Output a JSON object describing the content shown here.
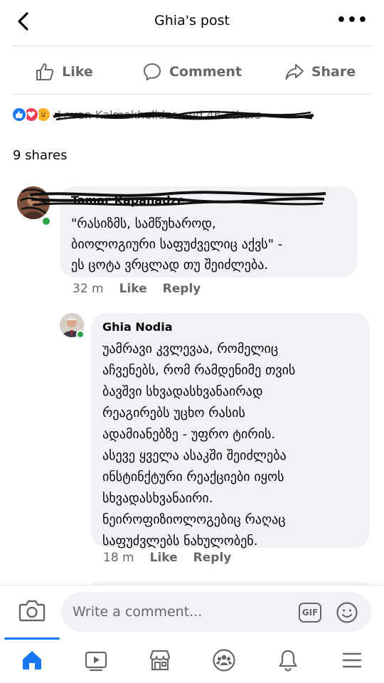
{
  "header": {
    "title": "Ghia's post",
    "more_label": "•••"
  },
  "actions": [
    {
      "label": "Like"
    },
    {
      "label": "Comment"
    },
    {
      "label": "Share"
    }
  ],
  "reactions": {
    "types": [
      "like",
      "love",
      "haha"
    ],
    "text": "Levan Kalmakhelidze and 46 others"
  },
  "shares": "9 shares",
  "comments": [
    {
      "author": "Tamar Kapanadze",
      "text": "\"რასიზმს, სამწუხაროდ,\nბიოლოგიური საფუძველიც აქვს\" -\nეს ცოტა ვრცლად თუ შეიძლება.",
      "time": "32 m",
      "like_label": "Like",
      "reply_label": "Reply"
    },
    {
      "author": "Ghia Nodia",
      "text": "უამრავი კვლევაა, რომელიც\nაჩვენებს, რომ რამდენიმე თვის\nბავშვი სხვადასხვანაირად\nრეაგირებს უცხო რასის\nადამიანებზე - უფრო ტირის.\nასევე ყველა ასაკში შეიძლება\nინსტინქტური რეაქციები იყოს\nსხვადასხვანაირი.\nნეიროფიზიოლოგებიც რაღაც\nსაფუძვლებს ნახულობენ.",
      "time": "18 m",
      "like_label": "Like",
      "reply_label": "Reply"
    }
  ],
  "composer": {
    "placeholder": "Write a comment...",
    "gif_label": "GIF"
  },
  "tabs": [
    "home-icon",
    "watch-icon",
    "marketplace-icon",
    "groups-icon",
    "notifications-icon",
    "menu-icon"
  ],
  "colors": {
    "accent": "#1877f2",
    "secondary_text": "#65676b",
    "bubble": "#f0f2f5",
    "online": "#31a24c"
  }
}
